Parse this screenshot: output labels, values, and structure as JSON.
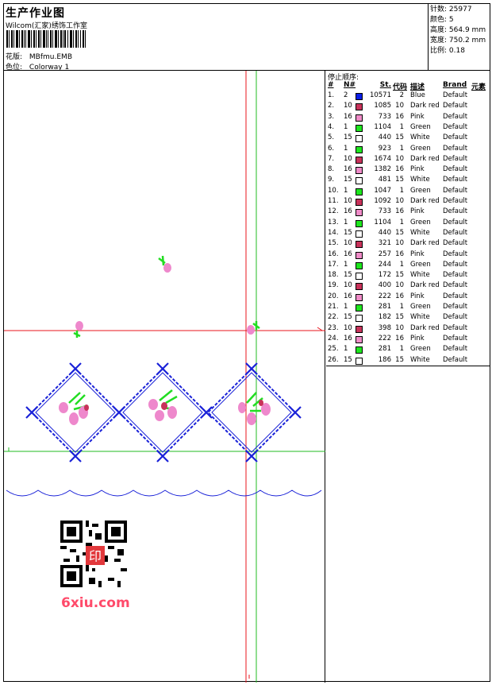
{
  "header": {
    "title": "生产作业图",
    "company": "Wilcom(汇家)绣饰工作室",
    "design_label": "花版:",
    "design_value": "MBfmu.EMB",
    "colorway_label": "色位:",
    "colorway_value": "Colorway 1"
  },
  "stats": [
    {
      "label": "针数:",
      "value": "25977"
    },
    {
      "label": "颜色:",
      "value": "5"
    },
    {
      "label": "高度:",
      "value": "564.9 mm"
    },
    {
      "label": "宽度:",
      "value": "750.2 mm"
    },
    {
      "label": "比例:",
      "value": "0.18"
    }
  ],
  "stops": {
    "title": "停止顺序:",
    "headers": {
      "idx": "#",
      "n": "N#",
      "st": "St.",
      "code": "代码",
      "desc": "描述",
      "brand": "Brand",
      "elem": "元素"
    },
    "rows": [
      {
        "idx": "1.",
        "n": "2",
        "color": "#0a1ee6",
        "st": "10571",
        "code": "2",
        "desc": "Blue",
        "brand": "Default"
      },
      {
        "idx": "2.",
        "n": "10",
        "color": "#c8325a",
        "st": "1085",
        "code": "10",
        "desc": "Dark red",
        "brand": "Default"
      },
      {
        "idx": "3.",
        "n": "16",
        "color": "#f08cc8",
        "st": "733",
        "code": "16",
        "desc": "Pink",
        "brand": "Default"
      },
      {
        "idx": "4.",
        "n": "1",
        "color": "#1ee61e",
        "st": "1104",
        "code": "1",
        "desc": "Green",
        "brand": "Default"
      },
      {
        "idx": "5.",
        "n": "15",
        "color": "#ffffff",
        "st": "440",
        "code": "15",
        "desc": "White",
        "brand": "Default"
      },
      {
        "idx": "6.",
        "n": "1",
        "color": "#1ee61e",
        "st": "923",
        "code": "1",
        "desc": "Green",
        "brand": "Default"
      },
      {
        "idx": "7.",
        "n": "10",
        "color": "#c8325a",
        "st": "1674",
        "code": "10",
        "desc": "Dark red",
        "brand": "Default"
      },
      {
        "idx": "8.",
        "n": "16",
        "color": "#f08cc8",
        "st": "1382",
        "code": "16",
        "desc": "Pink",
        "brand": "Default"
      },
      {
        "idx": "9.",
        "n": "15",
        "color": "#ffffff",
        "st": "481",
        "code": "15",
        "desc": "White",
        "brand": "Default"
      },
      {
        "idx": "10.",
        "n": "1",
        "color": "#1ee61e",
        "st": "1047",
        "code": "1",
        "desc": "Green",
        "brand": "Default"
      },
      {
        "idx": "11.",
        "n": "10",
        "color": "#c8325a",
        "st": "1092",
        "code": "10",
        "desc": "Dark red",
        "brand": "Default"
      },
      {
        "idx": "12.",
        "n": "16",
        "color": "#f08cc8",
        "st": "733",
        "code": "16",
        "desc": "Pink",
        "brand": "Default"
      },
      {
        "idx": "13.",
        "n": "1",
        "color": "#1ee61e",
        "st": "1104",
        "code": "1",
        "desc": "Green",
        "brand": "Default"
      },
      {
        "idx": "14.",
        "n": "15",
        "color": "#ffffff",
        "st": "440",
        "code": "15",
        "desc": "White",
        "brand": "Default"
      },
      {
        "idx": "15.",
        "n": "10",
        "color": "#c8325a",
        "st": "321",
        "code": "10",
        "desc": "Dark red",
        "brand": "Default"
      },
      {
        "idx": "16.",
        "n": "16",
        "color": "#f08cc8",
        "st": "257",
        "code": "16",
        "desc": "Pink",
        "brand": "Default"
      },
      {
        "idx": "17.",
        "n": "1",
        "color": "#1ee61e",
        "st": "244",
        "code": "1",
        "desc": "Green",
        "brand": "Default"
      },
      {
        "idx": "18.",
        "n": "15",
        "color": "#ffffff",
        "st": "172",
        "code": "15",
        "desc": "White",
        "brand": "Default"
      },
      {
        "idx": "19.",
        "n": "10",
        "color": "#c8325a",
        "st": "400",
        "code": "10",
        "desc": "Dark red",
        "brand": "Default"
      },
      {
        "idx": "20.",
        "n": "16",
        "color": "#f08cc8",
        "st": "222",
        "code": "16",
        "desc": "Pink",
        "brand": "Default"
      },
      {
        "idx": "21.",
        "n": "1",
        "color": "#1ee61e",
        "st": "281",
        "code": "1",
        "desc": "Green",
        "brand": "Default"
      },
      {
        "idx": "22.",
        "n": "15",
        "color": "#ffffff",
        "st": "182",
        "code": "15",
        "desc": "White",
        "brand": "Default"
      },
      {
        "idx": "23.",
        "n": "10",
        "color": "#c8325a",
        "st": "398",
        "code": "10",
        "desc": "Dark red",
        "brand": "Default"
      },
      {
        "idx": "24.",
        "n": "16",
        "color": "#f08cc8",
        "st": "222",
        "code": "16",
        "desc": "Pink",
        "brand": "Default"
      },
      {
        "idx": "25.",
        "n": "1",
        "color": "#1ee61e",
        "st": "281",
        "code": "1",
        "desc": "Green",
        "brand": "Default"
      },
      {
        "idx": "26.",
        "n": "15",
        "color": "#ffffff",
        "st": "186",
        "code": "15",
        "desc": "White",
        "brand": "Default"
      }
    ]
  },
  "design_colors": {
    "blue": "#1a22d8",
    "green": "#22dd22",
    "pink": "#ee88cc",
    "darkred": "#c8325a",
    "guide_red": "#e8141e",
    "guide_green": "#22bb22"
  },
  "watermark": {
    "text": "6xiu.com",
    "color": "#ff4a6a"
  },
  "seal_text": "印"
}
